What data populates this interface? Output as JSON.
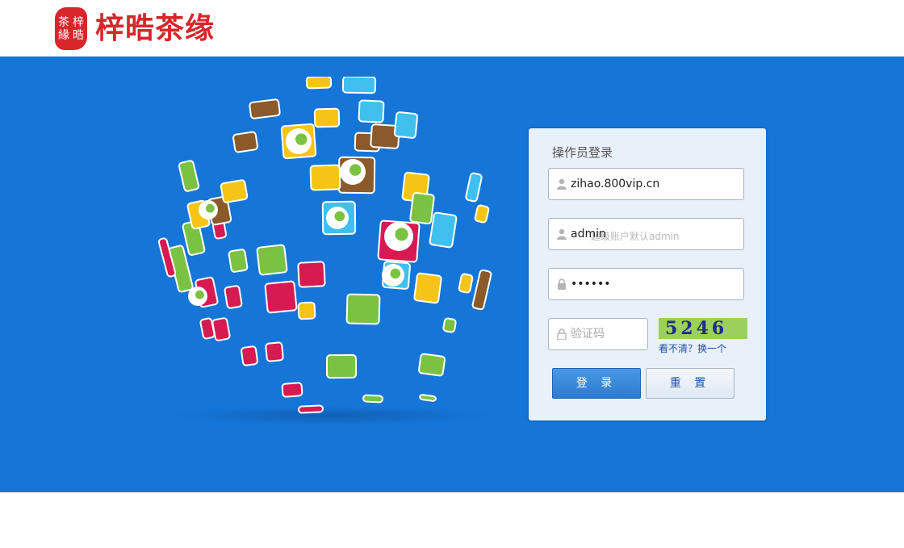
{
  "header": {
    "seal_chars": [
      "茶",
      "梓",
      "緣",
      "晧"
    ],
    "brand_name": "梓晧茶缘"
  },
  "login": {
    "title": "操作员登录",
    "company": {
      "value": "zihao.800vip.cn"
    },
    "username": {
      "value": "admin",
      "hint": "超级账户默认admin"
    },
    "password": {
      "value": "••••••"
    },
    "captcha": {
      "placeholder": "验证码",
      "image_text": "5246",
      "refresh_link": "看不清？换一个"
    },
    "login_button": "登 录",
    "reset_button": "重 置"
  },
  "colors": {
    "banner": "#1576d8",
    "brand_red": "#d8262b",
    "panel_bg": "#e8f0f9",
    "login_button": "#2b7ad1"
  },
  "icons": [
    "user-icon",
    "lock-icon",
    "globe-illustration"
  ]
}
